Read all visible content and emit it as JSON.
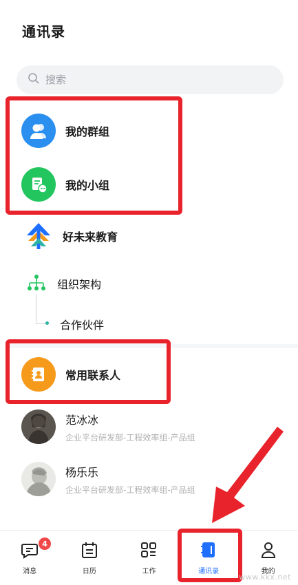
{
  "header": {
    "title": "通讯录"
  },
  "search": {
    "placeholder": "搜索"
  },
  "groups": {
    "my_groups": "我的群组",
    "my_teams": "我的小组"
  },
  "org": {
    "company": "好未来教育",
    "structure": "组织架构",
    "partners": "合作伙伴"
  },
  "frequent": {
    "label": "常用联系人"
  },
  "contacts": [
    {
      "name": "范冰冰",
      "dept": "企业平台研发部-工程效率组-产品组"
    },
    {
      "name": "杨乐乐",
      "dept": "企业平台研发部-工程效率组-产品组"
    }
  ],
  "tabs": [
    {
      "label": "消息",
      "badge": "4"
    },
    {
      "label": "日历"
    },
    {
      "label": "工作"
    },
    {
      "label": "通讯录",
      "active": true
    },
    {
      "label": "我的"
    }
  ],
  "watermark": "www.kkx.net",
  "colors": {
    "accent": "#1f6fff",
    "highlight": "#e8232c",
    "group_blue": "#2b8ff0",
    "team_green": "#22c55e",
    "contact_orange": "#f59a1b"
  }
}
